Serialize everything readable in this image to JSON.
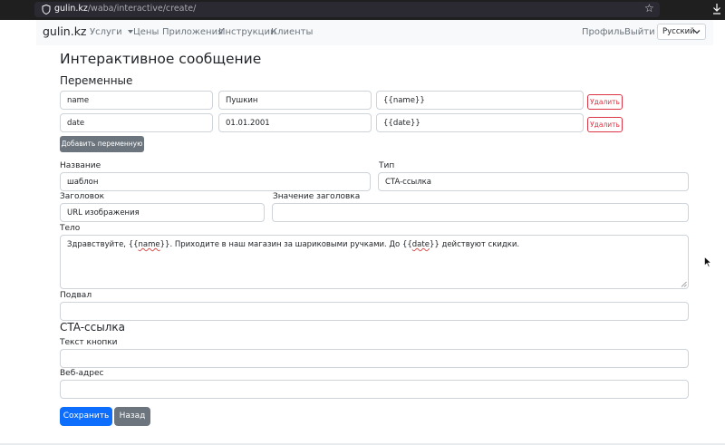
{
  "browser": {
    "url_host": "gulin.kz",
    "url_path": "/waba/interactive/create/"
  },
  "navbar": {
    "brand": "gulin.kz",
    "items": [
      {
        "label": "Услуги"
      },
      {
        "label": "Цены"
      },
      {
        "label": "Приложения"
      },
      {
        "label": "Инструкции"
      },
      {
        "label": "Клиенты"
      }
    ],
    "profile": "Профиль",
    "logout": "Выйти",
    "language": "Русский"
  },
  "page": {
    "title": "Интерактивное сообщение",
    "variables_heading": "Переменные",
    "variables": [
      {
        "name": "name",
        "value": "Пушкин",
        "placeholder": "{{name}}",
        "delete_label": "Удалить"
      },
      {
        "name": "date",
        "value": "01.01.2001",
        "placeholder": "{{date}}",
        "delete_label": "Удалить"
      }
    ],
    "add_variable_label": "Добавить переменную",
    "name_label": "Название",
    "name_value": "шаблон",
    "type_label": "Тип",
    "type_value": "CTA-ссылка",
    "header_label": "Заголовок",
    "header_value": "URL изображения",
    "header_value_label": "Значение заголовка",
    "header_value_value": "",
    "body_label": "Тело",
    "body_text": {
      "part1": "Здравствуйте, {{",
      "var1": "name",
      "part2": "}}. Приходите в наш магазин за шариковыми ручками. До {{",
      "var2": "date",
      "part3": "}} действуют скидки."
    },
    "footer_label": "Подвал",
    "footer_value": "",
    "cta_heading": "CTA-ссылка",
    "button_text_label": "Текст кнопки",
    "button_text_value": "",
    "web_address_label": "Веб-адрес",
    "web_address_value": "",
    "save_label": "Сохранить",
    "back_label": "Назад"
  }
}
